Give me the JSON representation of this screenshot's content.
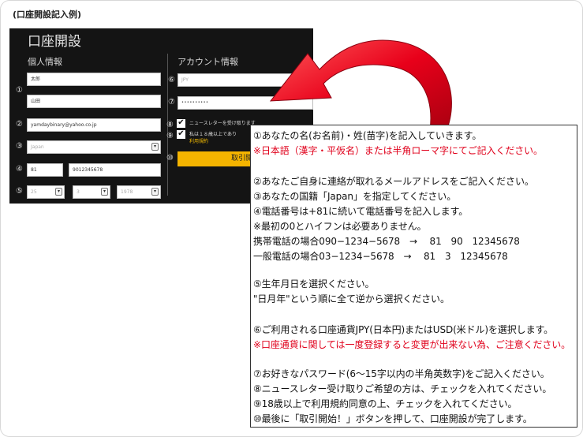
{
  "caption": "(口座開設記入例)",
  "form": {
    "title": "口座開設",
    "personal_title": "個人情報",
    "account_title": "アカウント情報",
    "numbers": [
      "①",
      "②",
      "③",
      "④",
      "⑤",
      "⑥",
      "⑦",
      "⑧",
      "⑨",
      "⑩"
    ],
    "first_name": "太郎",
    "last_name": "山田",
    "email": "yamdaybinary@yahoo.co.jp",
    "country": "Japan",
    "phone_code": "81",
    "phone_number": "9012345678",
    "birth_day": "25",
    "birth_month": "3",
    "birth_year": "1978",
    "currency": "JPY",
    "password": "••••••••••",
    "newsletter_label": "ニュースレターを受け取ります",
    "terms_label": "私は１８歳以上であり",
    "terms_link": "利用規約",
    "submit_label": "取引開"
  },
  "notes": [
    {
      "text": "①あなたの名(お名前)・姓(苗字)を記入していきます。",
      "red": false
    },
    {
      "text": "※日本語（漢字・平仮名）または半角ローマ字にてご記入ください。",
      "red": true
    },
    {
      "text": "②あなたご自身に連絡が取れるメールアドレスをご記入ください。",
      "red": false
    },
    {
      "text": "③あなたの国籍「Japan」を指定してください。",
      "red": false
    },
    {
      "text": "④電話番号は+81に続いて電話番号を記入します。",
      "red": false
    },
    {
      "text": "※最初の0とハイフンは必要ありません。",
      "red": false
    },
    {
      "text": "携帯電話の場合090−1234−5678　→　 81　90　12345678",
      "red": false
    },
    {
      "text": "一般電話の場合03−1234−5678　→　 81　3　12345678",
      "red": false
    },
    {
      "text": "⑤生年月日を選択ください。",
      "red": false
    },
    {
      "text": "\"日月年\"という順に全て逆から選択ください。",
      "red": false
    },
    {
      "text": "⑥ご利用される口座通貨JPY(日本円)またはUSD(米ドル)を選択します。",
      "red": false
    },
    {
      "text": "※口座通貨に関しては一度登録すると変更が出来ない為、ご注意ください。",
      "red": true
    },
    {
      "text": "⑦お好きなパスワード(6〜15字以内の半角英数字)をご記入ください。",
      "red": false
    },
    {
      "text": "⑧ニュースレター受け取りご希望の方は、チェックを入れてください。",
      "red": false
    },
    {
      "text": "⑨18歳以上で利用規約同意の上、チェックを入れてください。",
      "red": false
    },
    {
      "text": "⑩最後に「取引開始！」ボタンを押して、口座開設が完了します。",
      "red": false
    }
  ],
  "colors": {
    "panel": "#141414",
    "accent": "#f4b400",
    "arrow": "#e8001a",
    "warning": "#e0001b"
  }
}
